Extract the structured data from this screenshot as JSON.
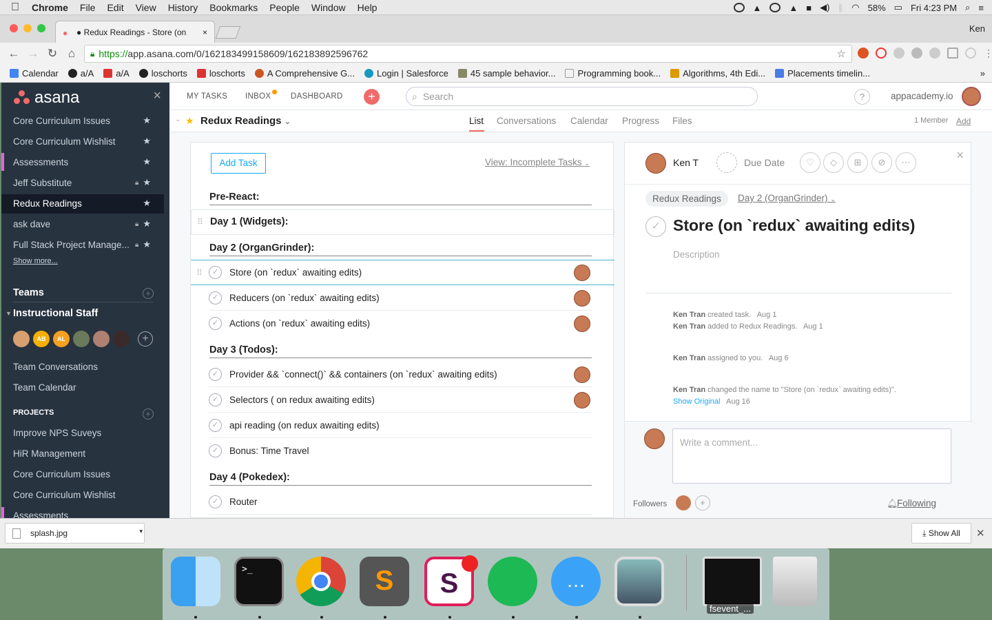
{
  "menubar": {
    "apple": "",
    "app": "Chrome",
    "items": [
      "File",
      "Edit",
      "View",
      "History",
      "Bookmarks",
      "People",
      "Window",
      "Help"
    ],
    "battery": "58%",
    "clock": "Fri 4:23 PM"
  },
  "browser": {
    "tab_title": "● Redux Readings - Store (on",
    "tab_close": "×",
    "profile": "Ken",
    "url_scheme": "https://",
    "url_rest": "app.asana.com/0/162183499158609/162183892596762",
    "bookmarks": [
      "Calendar",
      "a/A",
      "a/A",
      "loschorts",
      "loschorts",
      "A Comprehensive G...",
      "Login | Salesforce",
      "45 sample behavior...",
      "Programming book...",
      "Algorithms, 4th Edi...",
      "Placements timelin..."
    ],
    "more": "»"
  },
  "sidebar": {
    "logo": "asana",
    "close": "×",
    "favorites": [
      {
        "label": "Core Curriculum Issues",
        "lock": false
      },
      {
        "label": "Core Curriculum Wishlist",
        "lock": false
      },
      {
        "label": "Assessments",
        "lock": false
      },
      {
        "label": "Jeff Substitute",
        "lock": true
      },
      {
        "label": "Redux Readings",
        "lock": false
      },
      {
        "label": "ask dave",
        "lock": true
      },
      {
        "label": "Full Stack Project Manage...",
        "lock": true
      }
    ],
    "show_more": "Show more...",
    "teams_heading": "Teams",
    "team_name": "Instructional Staff",
    "team_avatars": [
      "",
      "AB",
      "AL",
      "",
      "",
      ""
    ],
    "team_links": [
      "Team Conversations",
      "Team Calendar"
    ],
    "projects_heading": "PROJECTS",
    "projects": [
      "Improve NPS Suveys",
      "HiR Management",
      "Core Curriculum Issues",
      "Core Curriculum Wishlist",
      "Assessments"
    ]
  },
  "topnav": {
    "my_tasks": "MY TASKS",
    "inbox": "INBOX",
    "dashboard": "DASHBOARD",
    "search_placeholder": "Search",
    "help": "?",
    "workspace": "appacademy.io"
  },
  "project": {
    "title": "Redux Readings",
    "tabs": [
      "List",
      "Conversations",
      "Calendar",
      "Progress",
      "Files"
    ],
    "active_tab": "List",
    "members": "1 Member",
    "add": "Add"
  },
  "list": {
    "add_task": "Add Task",
    "view": "View: Incomplete Tasks",
    "sections": [
      {
        "title": "Pre-React:"
      },
      {
        "title": "Day 1 (Widgets):"
      },
      {
        "title": "Day 2 (OrganGrinder):"
      },
      {
        "title": "Day 3 (Todos):"
      },
      {
        "title": "Day 4 (Pokedex):"
      }
    ],
    "tasks": [
      {
        "text": "Store (on `redux` awaiting edits)",
        "assigned": true
      },
      {
        "text": "Reducers (on `redux` awaiting edits)",
        "assigned": true
      },
      {
        "text": "Actions (on `redux` awaiting edits)",
        "assigned": true
      },
      {
        "text": "Provider && `connect()` && containers (on `redux` awaiting edits)",
        "assigned": true
      },
      {
        "text": "Selectors ( on redux awaiting edits)",
        "assigned": true
      },
      {
        "text": "api reading (on redux awaiting edits)",
        "assigned": false
      },
      {
        "text": "Bonus: Time Travel",
        "assigned": false
      },
      {
        "text": "Router",
        "assigned": false
      }
    ]
  },
  "detail": {
    "assignee": "Ken T",
    "due": "Due Date",
    "project_pill": "Redux Readings",
    "section": "Day 2 (OrganGrinder)",
    "title": "Store (on `redux` awaiting edits)",
    "description_placeholder": "Description",
    "activity": [
      {
        "who": "Ken Tran",
        "what": "created task.",
        "when": "Aug 1"
      },
      {
        "who": "Ken Tran",
        "what": "added to Redux Readings.",
        "when": "Aug 1"
      },
      {
        "who": "Ken Tran",
        "what": "assigned to you.",
        "when": "Aug 6"
      },
      {
        "who": "Ken Tran",
        "what": "changed the name to \"Store (on `redux` awaiting edits)\".",
        "when": "Aug 16",
        "link": "Show Original"
      }
    ],
    "comment_placeholder": "Write a comment...",
    "followers": "Followers",
    "following": "Following"
  },
  "downloads": {
    "file": "splash.jpg",
    "show_all": "Show All"
  },
  "dock": {
    "label": "fsevent_..."
  },
  "colors": {
    "sidebar_bg": "#283340",
    "asana_coral": "#f06a6a",
    "link_blue": "#14aaf5"
  }
}
